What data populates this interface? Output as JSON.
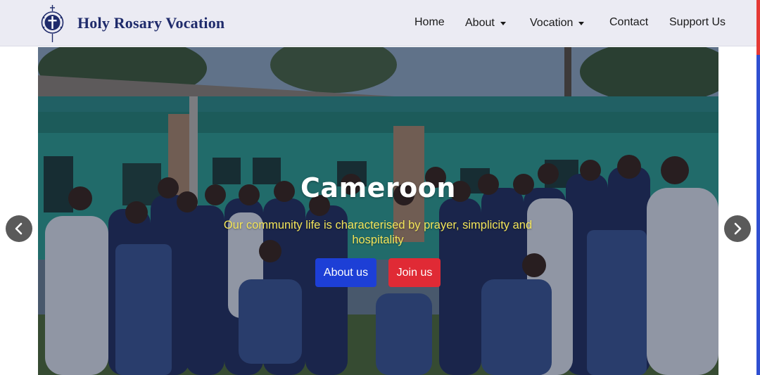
{
  "brand": {
    "name": "Holy Rosary Vocation",
    "logo_icon": "rosary-emblem-icon",
    "color": "#1f2b6b"
  },
  "nav": {
    "items": [
      {
        "label": "Home",
        "has_dropdown": false
      },
      {
        "label": "About",
        "has_dropdown": true
      },
      {
        "label": "Vocation",
        "has_dropdown": true
      },
      {
        "label": "Contact",
        "has_dropdown": false
      },
      {
        "label": "Support Us",
        "has_dropdown": false
      }
    ]
  },
  "hero": {
    "title": "Cameroon",
    "subtitle": "Our community life is characterised by prayer, simplicity and hospitality",
    "buttons": {
      "about": "About us",
      "join": "Join us"
    },
    "colors": {
      "subtitle": "#f2e45a",
      "about_button": "#1d3fd6",
      "join_button": "#e02a35"
    }
  },
  "carousel": {
    "prev_icon": "chevron-left-icon",
    "next_icon": "chevron-right-icon"
  }
}
